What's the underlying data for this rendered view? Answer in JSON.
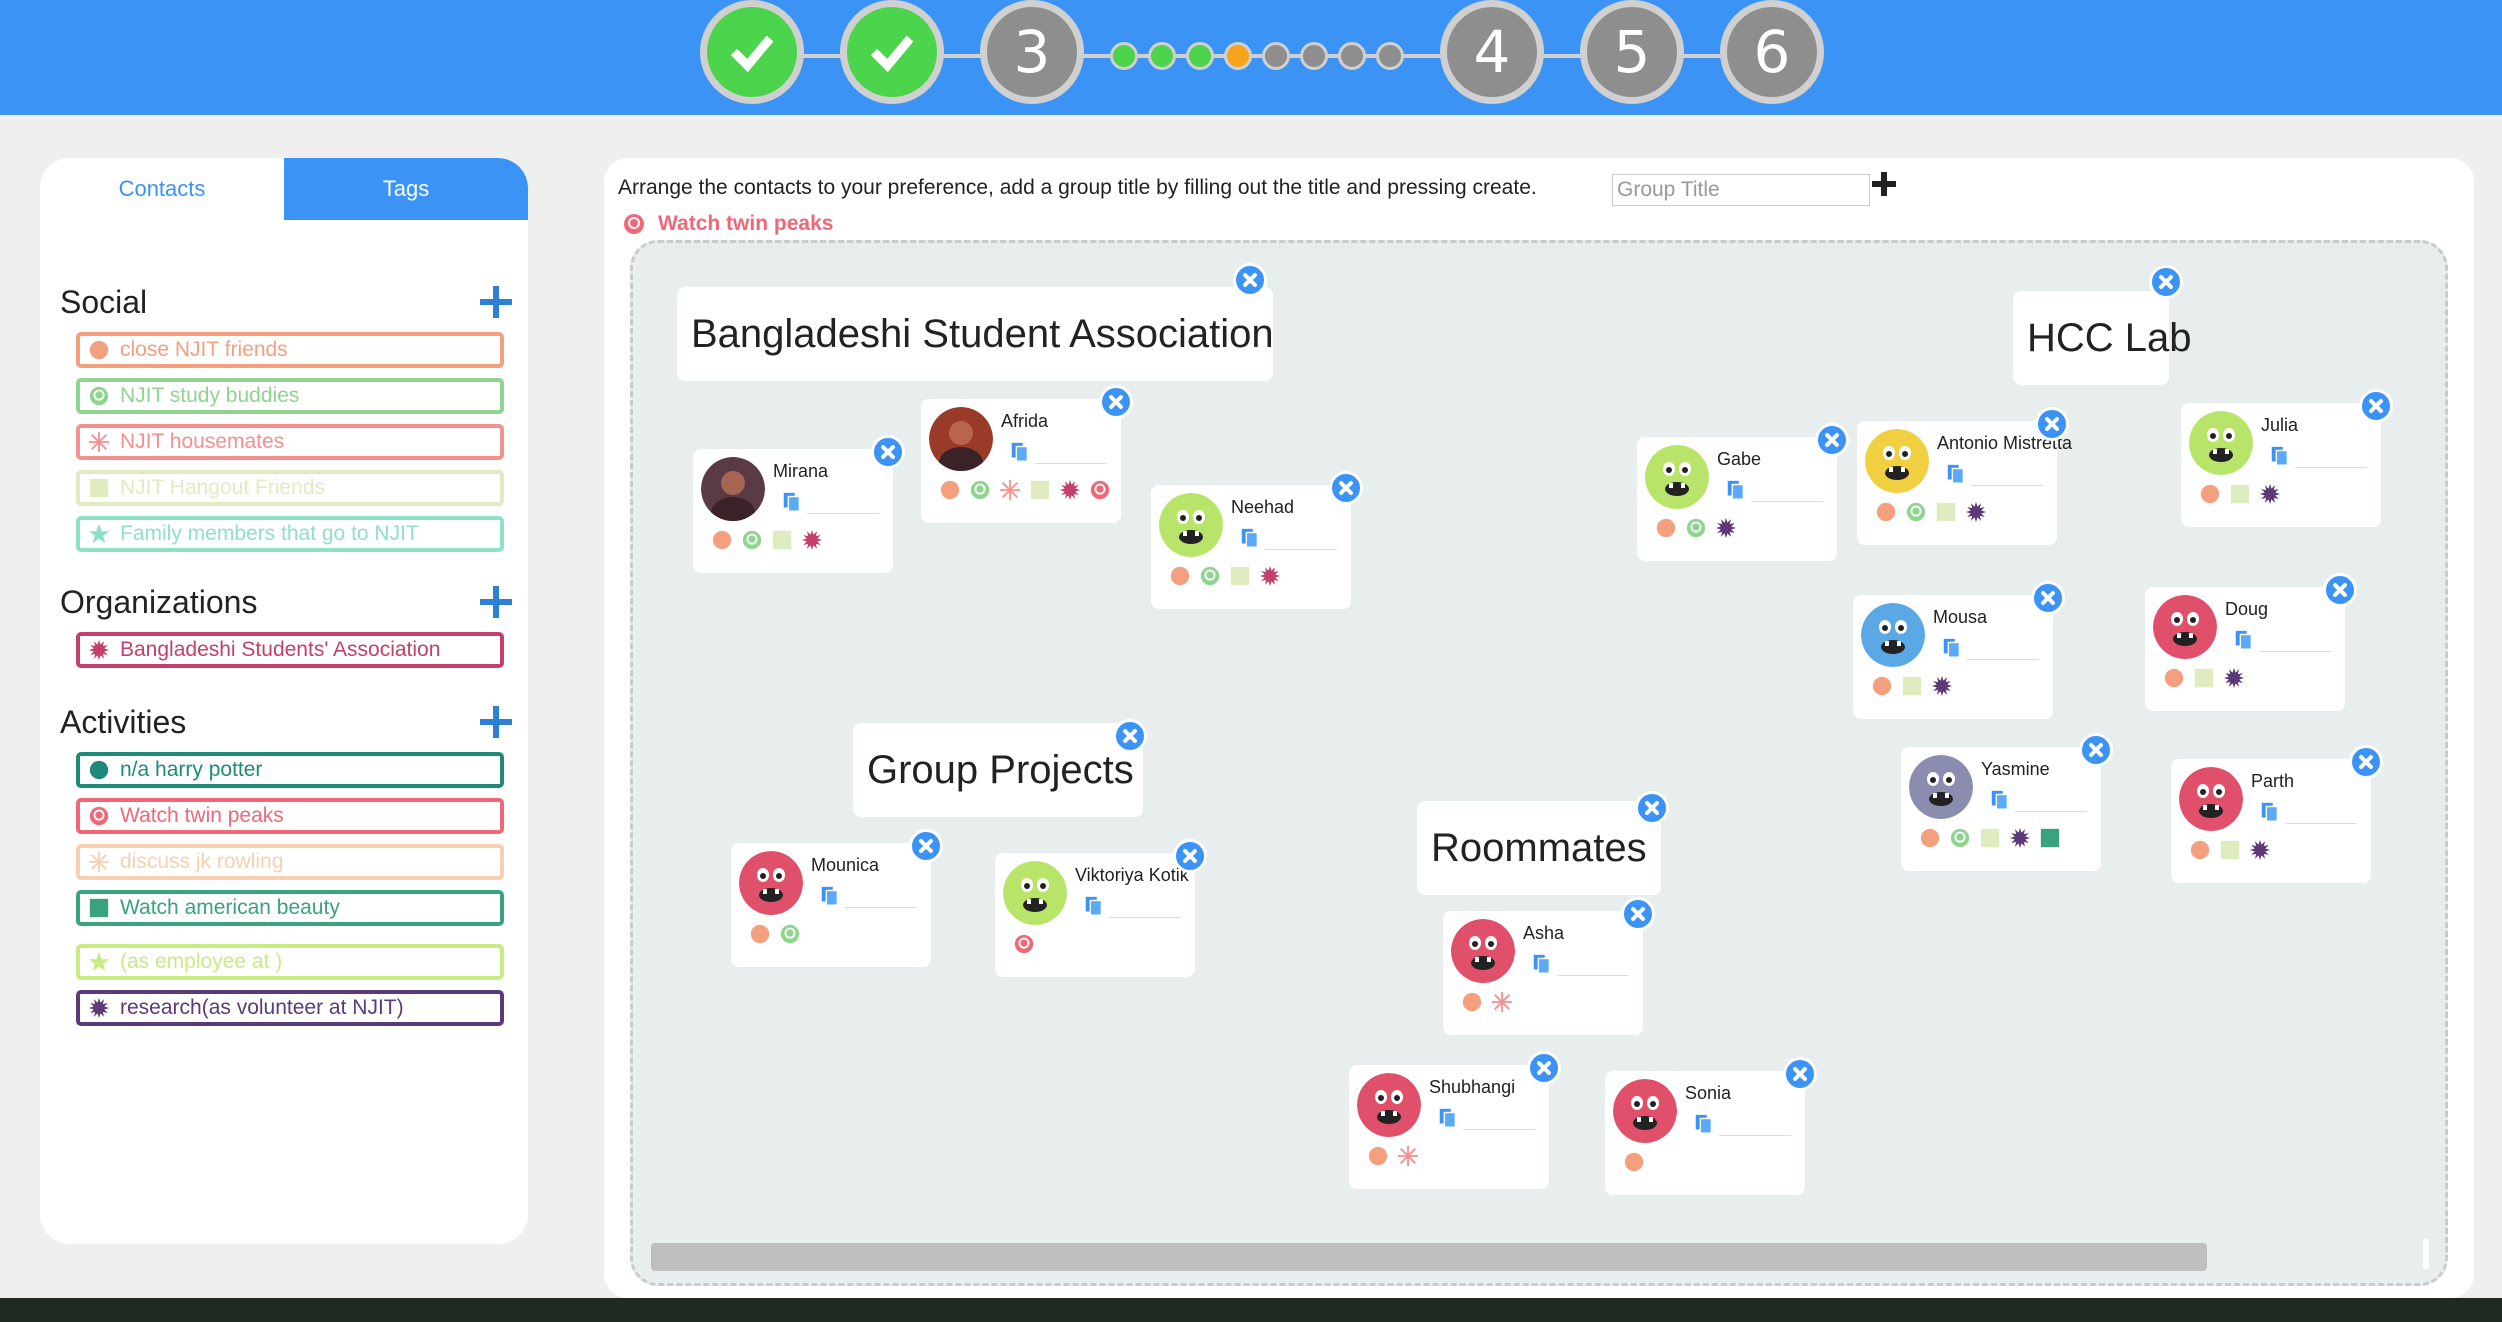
{
  "wizard": {
    "steps": [
      {
        "label": "",
        "state": "done",
        "icon": "check-icon"
      },
      {
        "label": "",
        "state": "done",
        "icon": "check-icon"
      },
      {
        "label": "3",
        "state": "current"
      },
      {
        "label": "4",
        "state": "todo"
      },
      {
        "label": "5",
        "state": "todo"
      },
      {
        "label": "6",
        "state": "todo"
      }
    ],
    "substeps": [
      "green",
      "green",
      "green",
      "orange",
      "grey",
      "grey",
      "grey",
      "grey"
    ]
  },
  "sidebar": {
    "tabs": {
      "contacts": "Contacts",
      "tags": "Tags"
    },
    "sections": [
      {
        "title": "Social",
        "tags": [
          {
            "label": "close NJIT friends",
            "color": "#f4a07e",
            "icon": "circle"
          },
          {
            "label": "NJIT study buddies",
            "color": "#8fd58f",
            "icon": "ring"
          },
          {
            "label": "NJIT housemates",
            "color": "#f49090",
            "icon": "burst"
          },
          {
            "label": "NJIT Hangout Friends",
            "color": "#dfecc0",
            "icon": "square"
          },
          {
            "label": "Family members that go to NJIT",
            "color": "#8fe0c8",
            "icon": "star"
          }
        ]
      },
      {
        "title": "Organizations",
        "tags": [
          {
            "label": "Bangladeshi Students' Association",
            "color": "#c2406a",
            "icon": "spiky"
          }
        ]
      },
      {
        "title": "Activities",
        "tags": [
          {
            "label": "n/a harry potter",
            "color": "#1f8a7a",
            "icon": "circle"
          },
          {
            "label": "Watch twin peaks",
            "color": "#f06878",
            "icon": "ring"
          },
          {
            "label": "discuss jk rowling",
            "color": "#f8d0b0",
            "icon": "burst"
          },
          {
            "label": "Watch american beauty",
            "color": "#3aa37e",
            "icon": "square"
          },
          {
            "label": "(as employee at )",
            "color": "#c8ec84",
            "icon": "star"
          },
          {
            "label": "research(as volunteer at NJIT)",
            "color": "#5c3a78",
            "icon": "spiky"
          }
        ]
      }
    ]
  },
  "main": {
    "instruction": "Arrange the contacts to your preference, add a group title by filling out the title and pressing create.",
    "group_title_placeholder": "Group Title",
    "active_tag": {
      "label": "Watch twin peaks",
      "color": "#f06878"
    },
    "group_titles": [
      "Bangladeshi Student Association",
      "HCC Lab",
      "Group Projects",
      "Roommates"
    ],
    "contacts": [
      {
        "name": "Mirana",
        "avatar": "photo-dark",
        "tags": [
          "#f4a07e:circle",
          "#8fd58f:ring",
          "#dfecc0:square",
          "#c2406a:spiky"
        ]
      },
      {
        "name": "Afrida",
        "avatar": "photo-red",
        "tags": [
          "#f4a07e:circle",
          "#8fd58f:ring",
          "#f49090:burst",
          "#dfecc0:square",
          "#c2406a:spiky",
          "#f06878:ring"
        ]
      },
      {
        "name": "Neehad",
        "avatar": "monster-green",
        "tags": [
          "#f4a07e:circle",
          "#8fd58f:ring",
          "#dfecc0:square",
          "#c2406a:spiky"
        ]
      },
      {
        "name": "Gabe",
        "avatar": "monster-green",
        "tags": [
          "#f4a07e:circle",
          "#8fd58f:ring",
          "#5c3a78:spiky"
        ]
      },
      {
        "name": "Antonio Mistretta",
        "avatar": "monster-yellow",
        "tags": [
          "#f4a07e:circle",
          "#8fd58f:ring",
          "#dfecc0:square",
          "#5c3a78:spiky"
        ]
      },
      {
        "name": "Julia",
        "avatar": "monster-green",
        "tags": [
          "#f4a07e:circle",
          "#dfecc0:square",
          "#5c3a78:spiky"
        ]
      },
      {
        "name": "Mousa",
        "avatar": "monster-blue",
        "tags": [
          "#f4a07e:circle",
          "#dfecc0:square",
          "#5c3a78:spiky"
        ]
      },
      {
        "name": "Doug",
        "avatar": "monster-red",
        "tags": [
          "#f4a07e:circle",
          "#dfecc0:square",
          "#5c3a78:spiky"
        ]
      },
      {
        "name": "Yasmine",
        "avatar": "monster-purple",
        "tags": [
          "#f4a07e:circle",
          "#8fd58f:ring",
          "#dfecc0:square",
          "#5c3a78:spiky",
          "#3aa37e:square"
        ]
      },
      {
        "name": "Parth",
        "avatar": "monster-red",
        "tags": [
          "#f4a07e:circle",
          "#dfecc0:square",
          "#5c3a78:spiky"
        ]
      },
      {
        "name": "Mounica",
        "avatar": "monster-red",
        "tags": [
          "#f4a07e:circle",
          "#8fd58f:ring"
        ]
      },
      {
        "name": "Viktoriya Kotik",
        "avatar": "monster-green",
        "tags": [
          "#f06878:ring"
        ]
      },
      {
        "name": "Asha",
        "avatar": "monster-red",
        "tags": [
          "#f4a07e:circle",
          "#f49090:burst"
        ]
      },
      {
        "name": "Shubhangi",
        "avatar": "monster-red",
        "tags": [
          "#f4a07e:circle",
          "#f49090:burst"
        ]
      },
      {
        "name": "Sonia",
        "avatar": "monster-red",
        "tags": [
          "#f4a07e:circle"
        ]
      }
    ]
  }
}
